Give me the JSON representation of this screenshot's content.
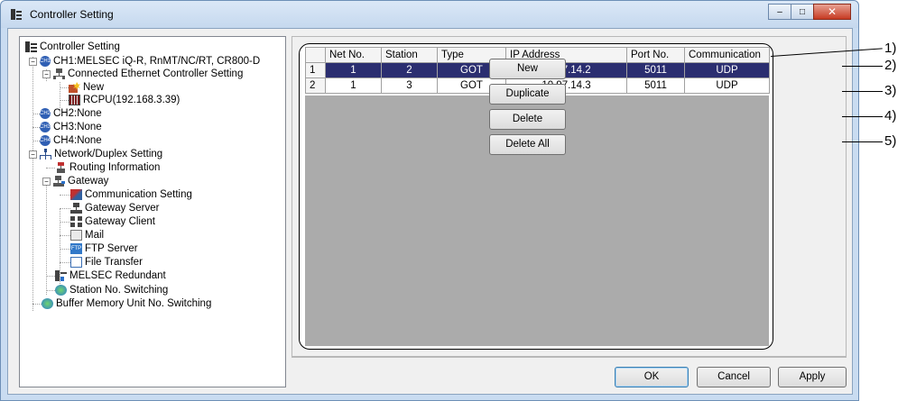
{
  "window": {
    "title": "Controller Setting",
    "controls": {
      "minimize": "–",
      "maximize": "□",
      "close": "✕"
    }
  },
  "tree": {
    "items": [
      {
        "label": "Controller Setting",
        "icon": "controller-setting-icon"
      },
      {
        "label": "CH1:MELSEC iQ-R, RnMT/NC/RT, CR800-D",
        "icon": "ch1-icon"
      },
      {
        "label": "Connected Ethernet Controller Setting",
        "icon": "network-icon"
      },
      {
        "label": "New",
        "icon": "new-item-icon"
      },
      {
        "label": "RCPU(192.168.3.39)",
        "icon": "plc-icon"
      },
      {
        "label": "CH2:None",
        "icon": "ch2-icon"
      },
      {
        "label": "CH3:None",
        "icon": "ch3-icon"
      },
      {
        "label": "CH4:None",
        "icon": "ch4-icon"
      },
      {
        "label": "Network/Duplex Setting",
        "icon": "network-duplex-icon"
      },
      {
        "label": "Routing Information",
        "icon": "routing-icon"
      },
      {
        "label": "Gateway",
        "icon": "gateway-icon"
      },
      {
        "label": "Communication Setting",
        "icon": "communication-icon"
      },
      {
        "label": "Gateway Server",
        "icon": "gateway-server-icon"
      },
      {
        "label": "Gateway Client",
        "icon": "gateway-client-icon"
      },
      {
        "label": "Mail",
        "icon": "mail-icon"
      },
      {
        "label": "FTP Server",
        "icon": "ftp-icon"
      },
      {
        "label": "File Transfer",
        "icon": "file-transfer-icon"
      },
      {
        "label": "MELSEC Redundant",
        "icon": "melsec-redundant-icon"
      },
      {
        "label": "Station No. Switching",
        "icon": "station-switching-icon"
      },
      {
        "label": "Buffer Memory Unit No. Switching",
        "icon": "buffer-memory-icon"
      }
    ],
    "ch_badges": {
      "ch1": "CH1",
      "ch2": "CH2",
      "ch3": "CH3",
      "ch4": "CH4",
      "ftp": "FTP"
    }
  },
  "grid": {
    "columns": [
      "",
      "Net No.",
      "Station",
      "Type",
      "IP Address",
      "Port No.",
      "Communication"
    ],
    "rows": [
      {
        "num": "1",
        "net": "1",
        "station": "2",
        "type": "GOT",
        "ip": "10.97.14.2",
        "port": "5011",
        "comm": "UDP",
        "selected": true
      },
      {
        "num": "2",
        "net": "1",
        "station": "3",
        "type": "GOT",
        "ip": "10.97.14.3",
        "port": "5011",
        "comm": "UDP",
        "selected": false
      }
    ]
  },
  "side_buttons": {
    "new": "New",
    "duplicate": "Duplicate",
    "delete": "Delete",
    "delete_all": "Delete All"
  },
  "bottom_buttons": {
    "ok": "OK",
    "cancel": "Cancel",
    "apply": "Apply"
  },
  "callouts": [
    "1)",
    "2)",
    "3)",
    "4)",
    "5)"
  ],
  "colors": {
    "selected_row": "#2b2e70",
    "grid_empty": "#ababab",
    "title_bar": "#c9dcf1"
  }
}
